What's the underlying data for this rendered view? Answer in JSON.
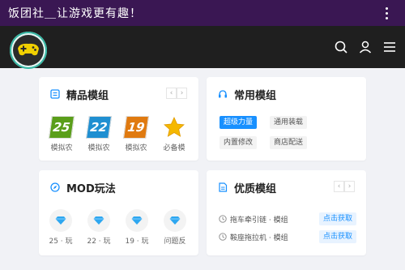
{
  "app": {
    "title": "饭团社＿让游戏更有趣！"
  },
  "cards": {
    "featured": {
      "title": "精品模组",
      "items": [
        {
          "badge": "25",
          "label": "模拟农",
          "color": "#5a9e1a"
        },
        {
          "badge": "22",
          "label": "模拟农",
          "color": "#1f8fd1"
        },
        {
          "badge": "19",
          "label": "模拟农",
          "color": "#e07a10"
        },
        {
          "badge": "",
          "label": "必备模",
          "color": "#f5b800"
        }
      ]
    },
    "common": {
      "title": "常用模组",
      "tags": [
        "超级力量",
        "通用装载",
        "内置修改",
        "商店配送"
      ]
    },
    "mod": {
      "title": "MOD玩法",
      "items": [
        {
          "label": "25 · 玩"
        },
        {
          "label": "22 · 玩"
        },
        {
          "label": "19 · 玩"
        },
        {
          "label": "问题反"
        }
      ]
    },
    "quality": {
      "title": "优质模组",
      "rows": [
        {
          "text": "拖车牵引链 · 模组",
          "button": "点击获取"
        },
        {
          "text": "鞍座拖拉机 · 模组",
          "button": "点击获取"
        }
      ]
    }
  },
  "pager": {
    "prev": "‹",
    "next": "›"
  },
  "colors": {
    "titlebar": "#3a1753",
    "header": "#1f1f1f",
    "accent": "#1890ff",
    "logo_ring": "#36b6a3"
  }
}
